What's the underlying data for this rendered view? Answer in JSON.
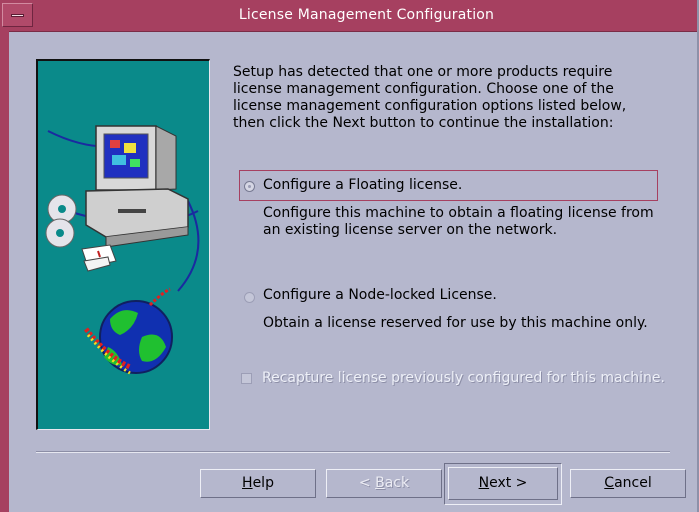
{
  "window": {
    "title": "License Management Configuration",
    "accent_color": "#a64060",
    "background_color": "#b5b7cd"
  },
  "intro_text": "Setup has detected that one or more products require\nlicense management configuration. Choose one of the\nlicense management configuration options listed below,\nthen click the Next button to continue the installation:",
  "options": [
    {
      "label": "Configure a Floating license.",
      "description": "Configure this machine to obtain a floating license from\nan existing license server on the network.",
      "selected": true
    },
    {
      "label": "Configure a Node-locked License.",
      "description": "Obtain a license reserved for use by this machine only.",
      "selected": false
    }
  ],
  "recapture_checkbox": {
    "label": "Recapture license previously configured for this machine.",
    "checked": false,
    "enabled": false
  },
  "buttons": {
    "help": {
      "mnemonic": "H",
      "rest": "elp"
    },
    "back": {
      "prefix": "< ",
      "mnemonic": "B",
      "rest": "ack",
      "enabled": false
    },
    "next": {
      "mnemonic": "N",
      "rest": "ext >",
      "default": true
    },
    "cancel": {
      "mnemonic": "C",
      "rest": "ancel"
    }
  }
}
